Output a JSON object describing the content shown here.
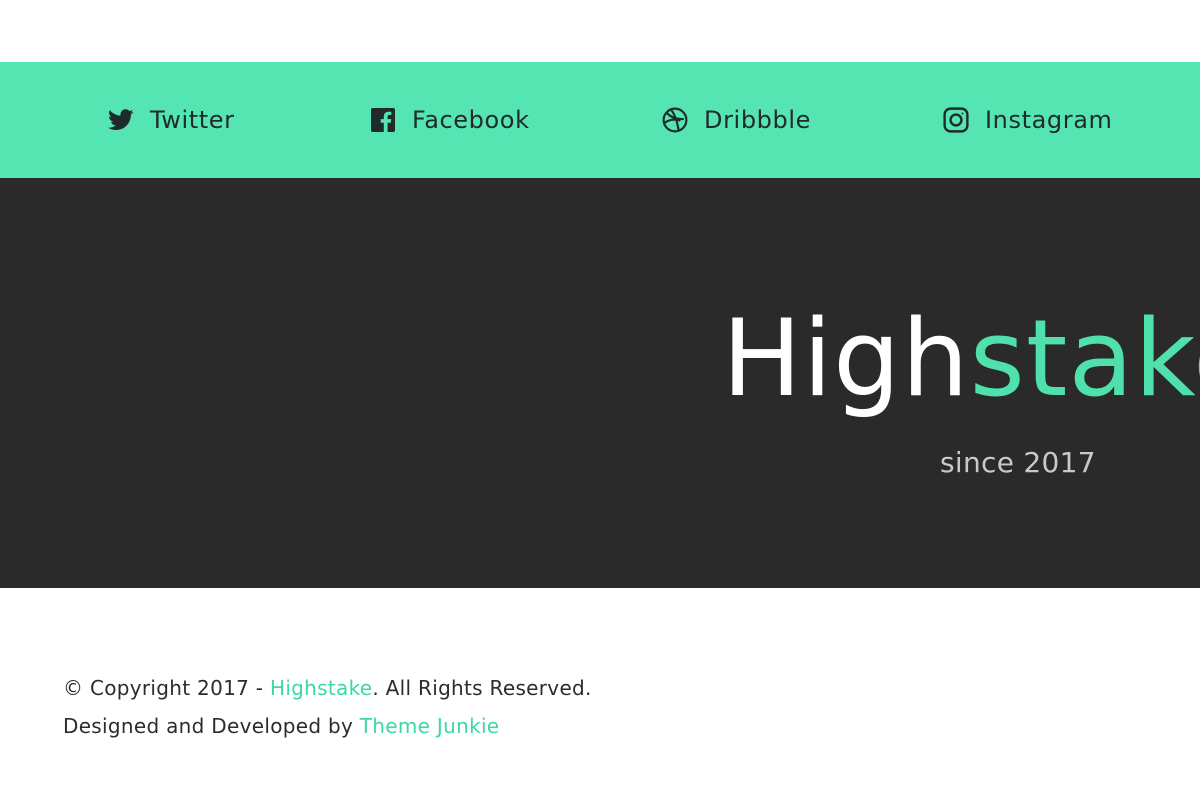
{
  "social": {
    "twitter": {
      "label": "Twitter",
      "icon": "twitter-icon"
    },
    "facebook": {
      "label": "Facebook",
      "icon": "facebook-icon"
    },
    "dribbble": {
      "label": "Dribbble",
      "icon": "dribbble-icon"
    },
    "instagram": {
      "label": "Instagram",
      "icon": "instagram-icon"
    }
  },
  "hero": {
    "brand_part_a": "High",
    "brand_part_b": "stake",
    "tagline": "since 2017"
  },
  "footer": {
    "copyright_prefix": "© Copyright 2017 - ",
    "copyright_link": "Highstake",
    "copyright_suffix": ". All Rights Reserved.",
    "credit_prefix": "Designed and Developed by ",
    "credit_link": "Theme Junkie"
  },
  "colors": {
    "social_bar": "#55e5b2",
    "hero_background": "#2a2a2a",
    "accent": "#3cd9a2",
    "brand_white": "#ffffff"
  }
}
